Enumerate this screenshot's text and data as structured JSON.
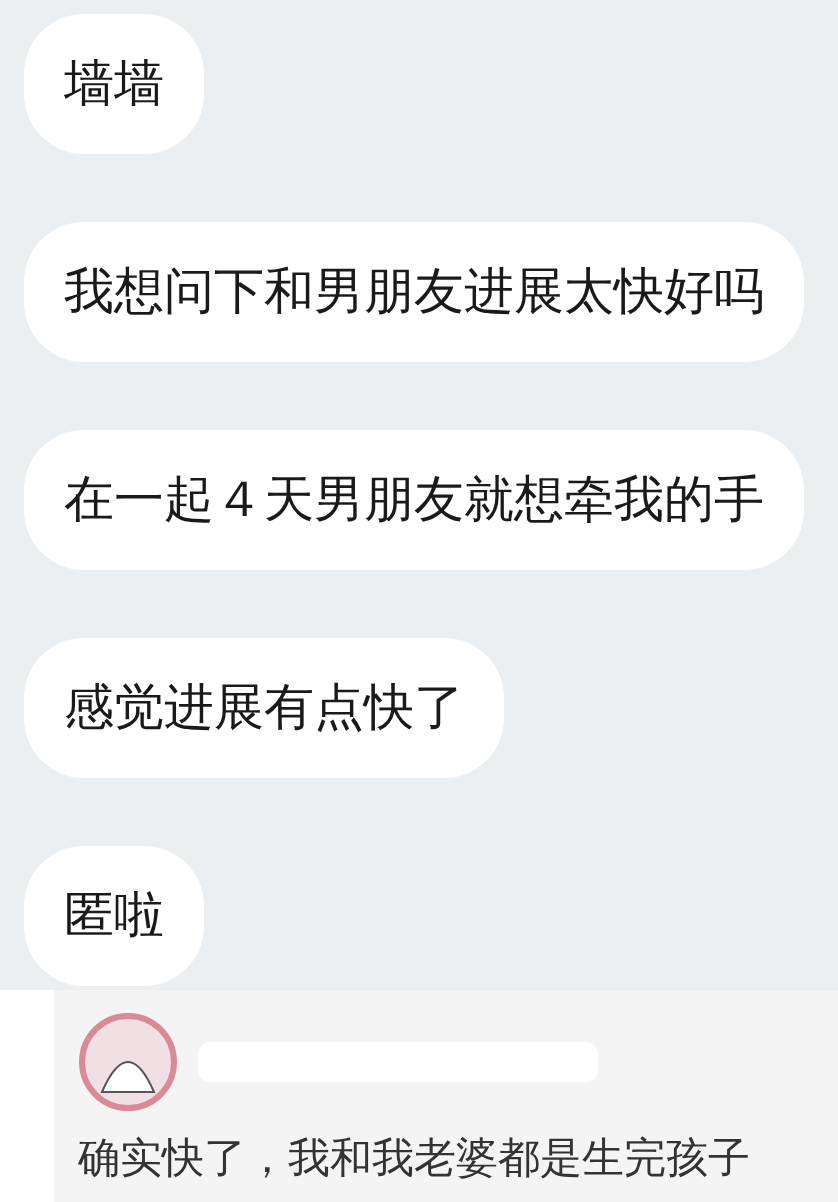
{
  "messages": [
    {
      "text": "墙墙"
    },
    {
      "text": "我想问下和男朋友进展太快好吗"
    },
    {
      "text": "在一起４天男朋友就想牵我的手"
    },
    {
      "text": "感觉进展有点快了"
    },
    {
      "text": "匿啦"
    }
  ],
  "comment": {
    "text": "确实快了，我和我老婆都是生完孩子"
  }
}
